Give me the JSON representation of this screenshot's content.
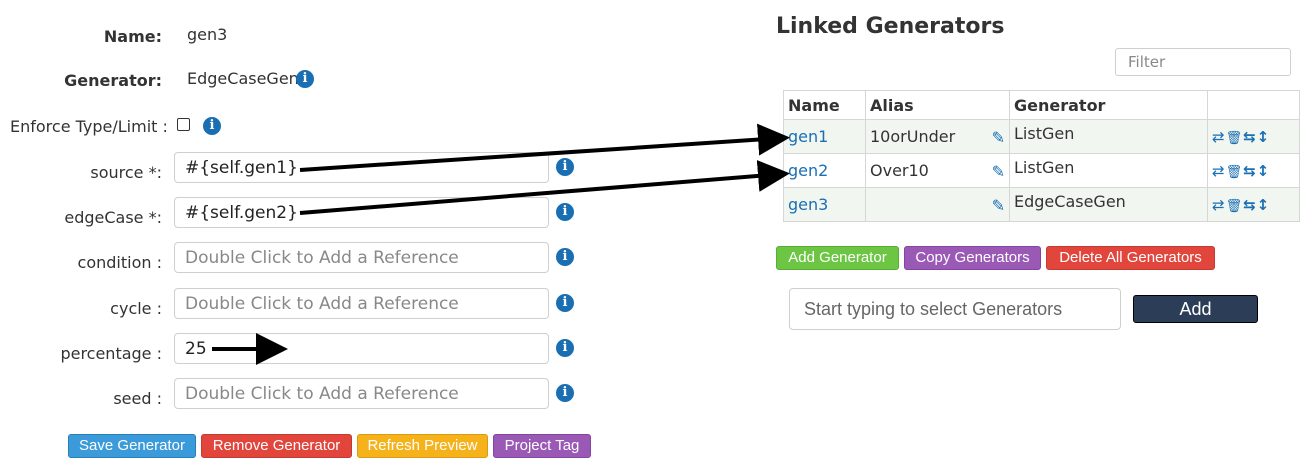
{
  "form": {
    "name_label": "Name:",
    "name_value": "gen3",
    "generator_label": "Generator:",
    "generator_value": "EdgeCaseGen",
    "enforce_label": "Enforce Type/Limit :",
    "fields": [
      {
        "label": "source *:",
        "value": "#{self.gen1}",
        "placeholder": ""
      },
      {
        "label": "edgeCase *:",
        "value": "#{self.gen2}",
        "placeholder": ""
      },
      {
        "label": "condition :",
        "value": "",
        "placeholder": "Double Click to Add a Reference"
      },
      {
        "label": "cycle :",
        "value": "",
        "placeholder": "Double Click to Add a Reference"
      },
      {
        "label": "percentage :",
        "value": "25",
        "placeholder": ""
      },
      {
        "label": "seed :",
        "value": "",
        "placeholder": "Double Click to Add a Reference"
      }
    ],
    "info_glyph": "i"
  },
  "form_buttons": {
    "save": "Save Generator",
    "remove": "Remove Generator",
    "refresh": "Refresh Preview",
    "tag": "Project Tag"
  },
  "linked": {
    "title": "Linked Generators",
    "filter_placeholder": "Filter",
    "headers": [
      "Name",
      "Alias",
      "Generator",
      ""
    ],
    "rows": [
      {
        "name": "gen1",
        "alias": "10orUnder",
        "generator": "ListGen"
      },
      {
        "name": "gen2",
        "alias": "Over10",
        "generator": "ListGen"
      },
      {
        "name": "gen3",
        "alias": "",
        "generator": "EdgeCaseGen"
      }
    ],
    "buttons": {
      "add": "Add Generator",
      "copy": "Copy Generators",
      "delete_all": "Delete All Generators"
    },
    "select_placeholder": "Start typing to select Generators",
    "add_label": "Add"
  },
  "icons": {
    "pencil": "✎",
    "refresh": "⇄",
    "trash": "🗑",
    "swap": "⇆",
    "move": "↕"
  },
  "colors": {
    "link": "#1a6fb3",
    "save": "#3b9ad9",
    "remove": "#e2453c",
    "refresh": "#f6b21b",
    "tag": "#9b59b6",
    "add_generator": "#6cc644",
    "add_button": "#2c3e57"
  }
}
